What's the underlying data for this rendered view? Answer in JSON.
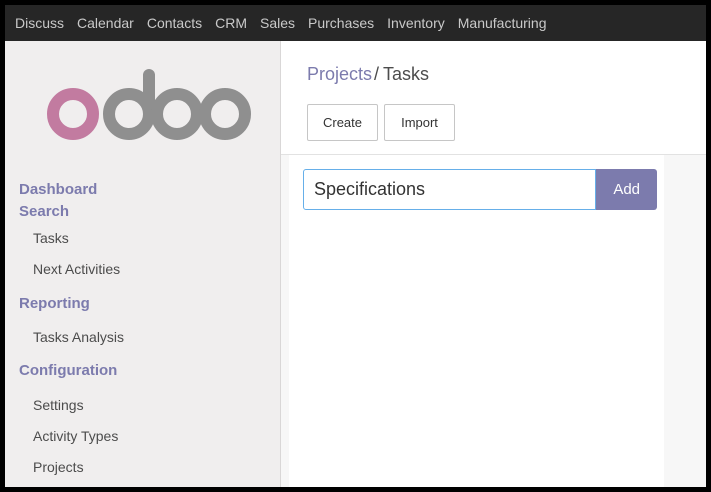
{
  "topbar": {
    "menu": [
      "Discuss",
      "Calendar",
      "Contacts",
      "CRM",
      "Sales",
      "Purchases",
      "Inventory",
      "Manufacturing"
    ]
  },
  "logo": {
    "text": "odoo",
    "colors": {
      "o1": "#c27ba0",
      "rest": "#8f8f8f"
    }
  },
  "sidebar": {
    "sections": [
      {
        "title": "Dashboard",
        "items": []
      },
      {
        "title": "Search",
        "items": [
          "Tasks",
          "Next Activities"
        ]
      },
      {
        "title": "Reporting",
        "items": [
          "Tasks Analysis"
        ]
      },
      {
        "title": "Configuration",
        "items": [
          "Settings",
          "Activity Types",
          "Projects"
        ]
      }
    ]
  },
  "breadcrumb": {
    "parent": "Projects",
    "separator": "/",
    "current": "Tasks"
  },
  "buttons": {
    "create": "Create",
    "import": "Import"
  },
  "quick_create": {
    "value": "Specifications",
    "add_label": "Add"
  },
  "colors": {
    "accent": "#7c7bad",
    "topbar": "#262626",
    "sidebar": "#f0eeee"
  }
}
